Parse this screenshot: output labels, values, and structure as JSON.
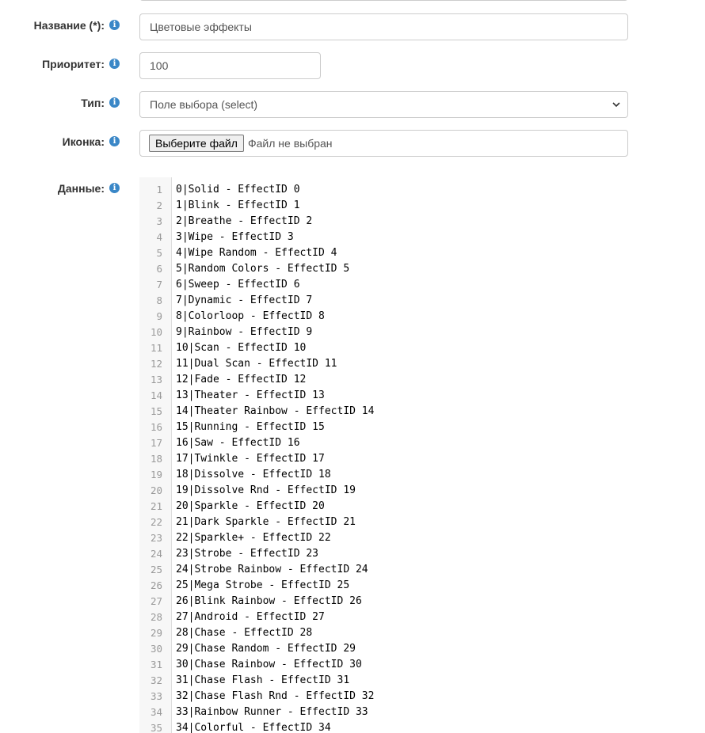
{
  "form": {
    "name": {
      "label": "Название (*):",
      "value": "Цветовые эффекты"
    },
    "priority": {
      "label": "Приоритет:",
      "value": "100"
    },
    "type": {
      "label": "Тип:",
      "selected": "Поле выбора (select)"
    },
    "icon": {
      "label": "Иконка:",
      "button": "Выберите файл",
      "status": "Файл не выбран"
    },
    "data": {
      "label": "Данные:",
      "lines": [
        "0|Solid - EffectID 0",
        "1|Blink - EffectID 1",
        "2|Breathe - EffectID 2",
        "3|Wipe - EffectID 3",
        "4|Wipe Random - EffectID 4",
        "5|Random Colors - EffectID 5",
        "6|Sweep - EffectID 6",
        "7|Dynamic - EffectID 7",
        "8|Colorloop - EffectID 8",
        "9|Rainbow - EffectID 9",
        "10|Scan - EffectID 10",
        "11|Dual Scan - EffectID 11",
        "12|Fade - EffectID 12",
        "13|Theater - EffectID 13",
        "14|Theater Rainbow - EffectID 14",
        "15|Running - EffectID 15",
        "16|Saw - EffectID 16",
        "17|Twinkle - EffectID 17",
        "18|Dissolve - EffectID 18",
        "19|Dissolve Rnd - EffectID 19",
        "20|Sparkle - EffectID 20",
        "21|Dark Sparkle - EffectID 21",
        "22|Sparkle+ - EffectID 22",
        "23|Strobe - EffectID 23",
        "24|Strobe Rainbow - EffectID 24",
        "25|Mega Strobe - EffectID 25",
        "26|Blink Rainbow - EffectID 26",
        "27|Android - EffectID 27",
        "28|Chase - EffectID 28",
        "29|Chase Random - EffectID 29",
        "30|Chase Rainbow - EffectID 30",
        "31|Chase Flash - EffectID 31",
        "32|Chase Flash Rnd - EffectID 32",
        "33|Rainbow Runner - EffectID 33",
        "34|Colorful - EffectID 34"
      ]
    }
  },
  "colors": {
    "info_icon": "#3a87c7",
    "border": "#cccccc",
    "gutter": "#f7f7f7"
  },
  "icons": {
    "info": "info-icon",
    "select_arrow": "chevron-down-icon"
  }
}
